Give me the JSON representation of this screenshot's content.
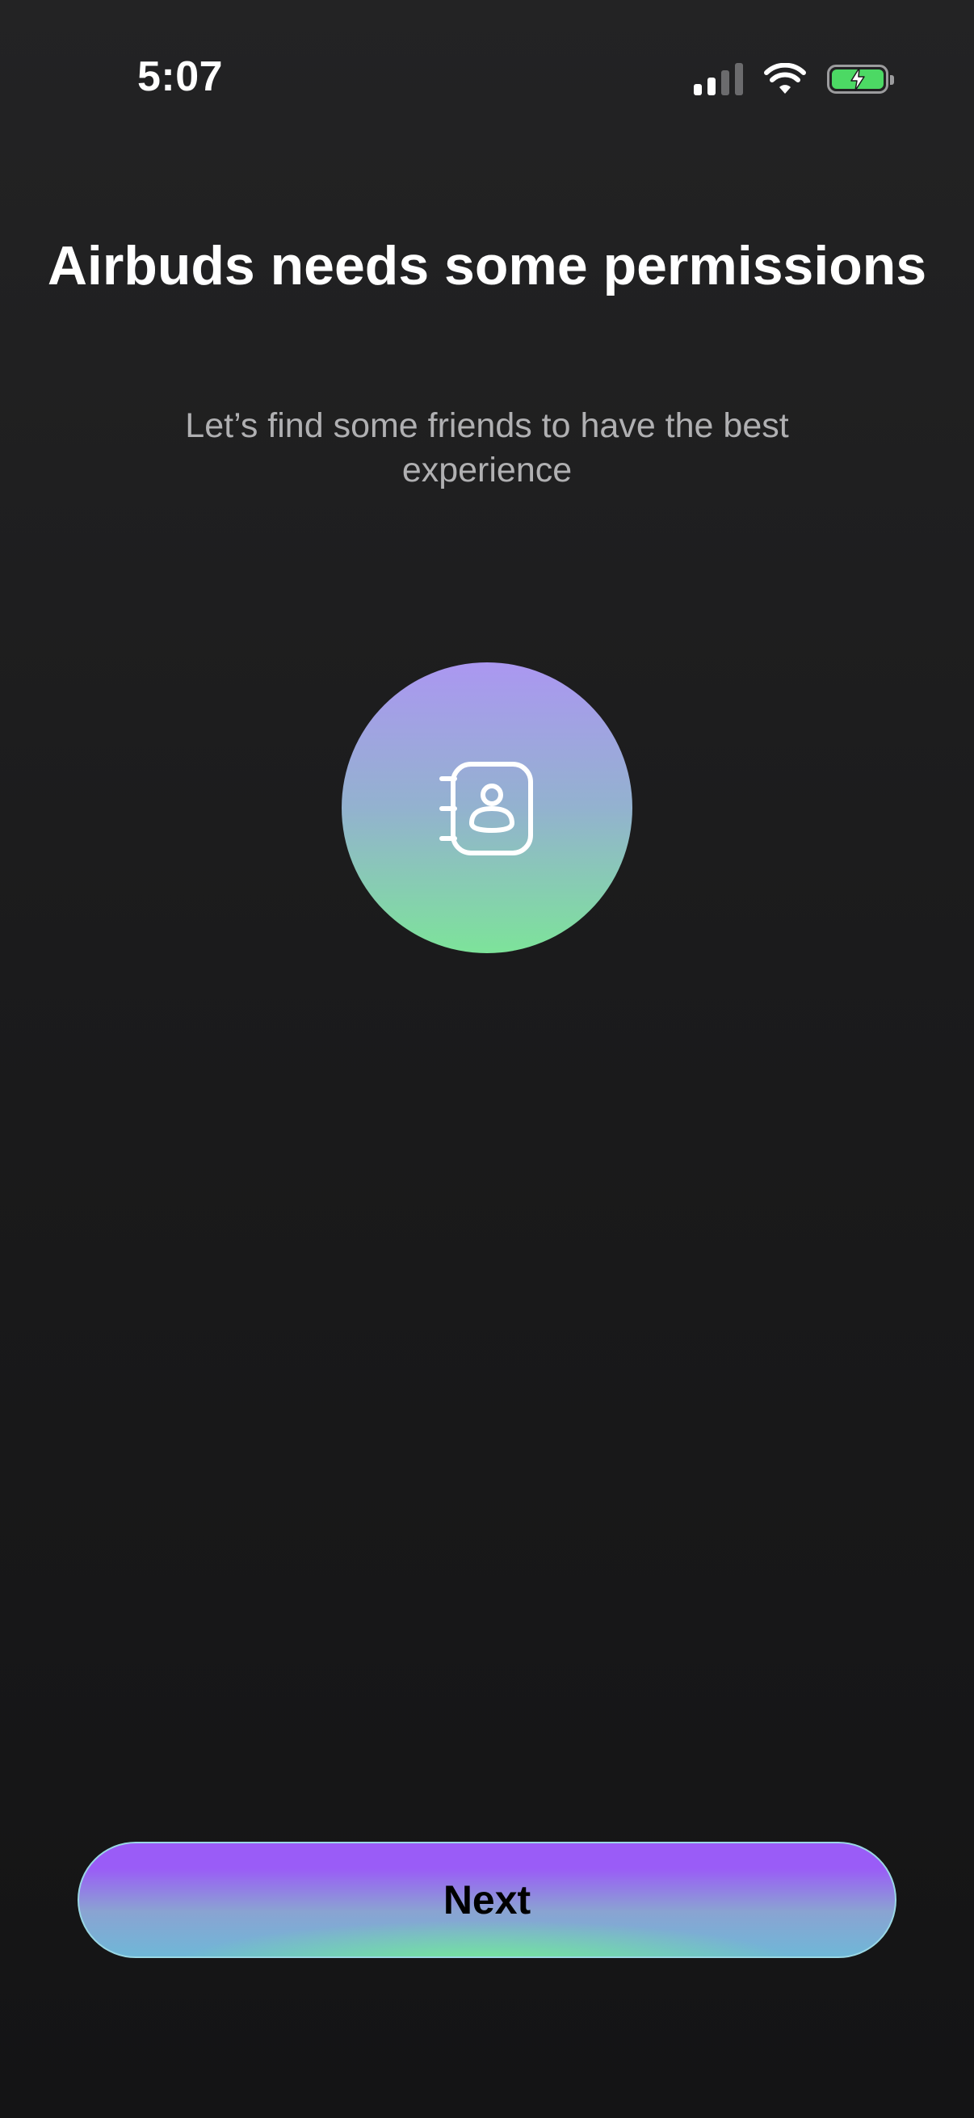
{
  "status_bar": {
    "time": "5:07",
    "icons": [
      "cellular-signal-icon",
      "wifi-icon",
      "battery-charging-icon"
    ],
    "battery_color": "#4cd964"
  },
  "onboarding": {
    "title": "Airbuds needs some permissions",
    "subtitle": "Let’s find some friends to have the best experience",
    "feature_icon": "contacts-book-icon",
    "circle_gradient": [
      "#ab97f1",
      "#7de39a"
    ]
  },
  "actions": {
    "next_label": "Next",
    "button_gradient": [
      "#9a5cf7",
      "#78f08c"
    ]
  }
}
